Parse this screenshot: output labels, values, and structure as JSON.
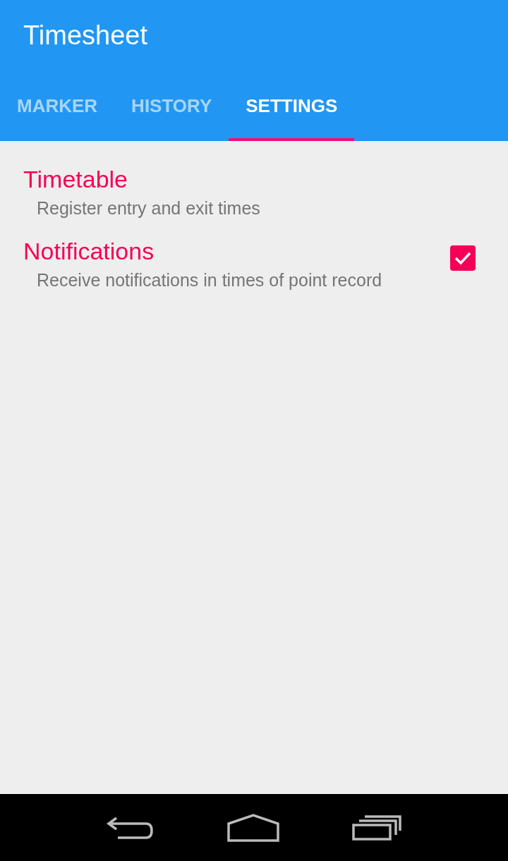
{
  "app_bar": {
    "title": "Timesheet"
  },
  "tabs": [
    {
      "label": "MARKER",
      "selected": false
    },
    {
      "label": "HISTORY",
      "selected": false
    },
    {
      "label": "SETTINGS",
      "selected": true
    }
  ],
  "settings": [
    {
      "kind": "text",
      "title": "Timetable",
      "summary": "Register entry and exit times"
    },
    {
      "kind": "checkbox",
      "title": "Notifications",
      "summary": "Receive notifications in times of point record",
      "checked": true
    }
  ]
}
